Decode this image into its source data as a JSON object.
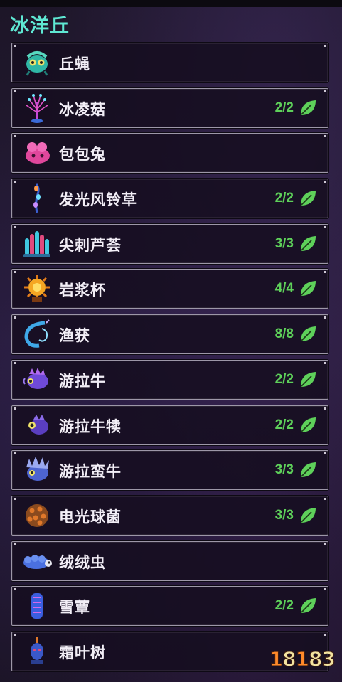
{
  "region": {
    "title": "冰洋丘"
  },
  "items": [
    {
      "name": "丘蝇",
      "count": "",
      "icon": "teal-fly-creature-icon"
    },
    {
      "name": "冰凌菇",
      "count": "2/2",
      "icon": "ice-mushroom-icon"
    },
    {
      "name": "包包兔",
      "count": "",
      "icon": "pink-bunny-icon"
    },
    {
      "name": "发光风铃草",
      "count": "2/2",
      "icon": "glowing-bellflower-icon"
    },
    {
      "name": "尖刺芦荟",
      "count": "3/3",
      "icon": "spiky-aloe-icon"
    },
    {
      "name": "岩浆杯",
      "count": "4/4",
      "icon": "magma-cup-icon"
    },
    {
      "name": "渔获",
      "count": "8/8",
      "icon": "fishing-hook-icon"
    },
    {
      "name": "游拉牛",
      "count": "2/2",
      "icon": "swim-bull-icon"
    },
    {
      "name": "游拉牛犊",
      "count": "2/2",
      "icon": "swim-calf-icon"
    },
    {
      "name": "游拉蛮牛",
      "count": "3/3",
      "icon": "swim-brute-icon"
    },
    {
      "name": "电光球菌",
      "count": "3/3",
      "icon": "electric-spore-icon"
    },
    {
      "name": "绒绒虫",
      "count": "",
      "icon": "fuzzy-worm-icon"
    },
    {
      "name": "雪蕈",
      "count": "2/2",
      "icon": "snow-fungus-icon"
    },
    {
      "name": "霜叶树",
      "count": "",
      "icon": "frost-leaf-tree-icon"
    }
  ],
  "watermark": {
    "text": "18183"
  },
  "colors": {
    "title": "#5fe8d3",
    "count": "#5ed05a",
    "leaf": "#5ed05a",
    "border": "#9d97a8"
  }
}
